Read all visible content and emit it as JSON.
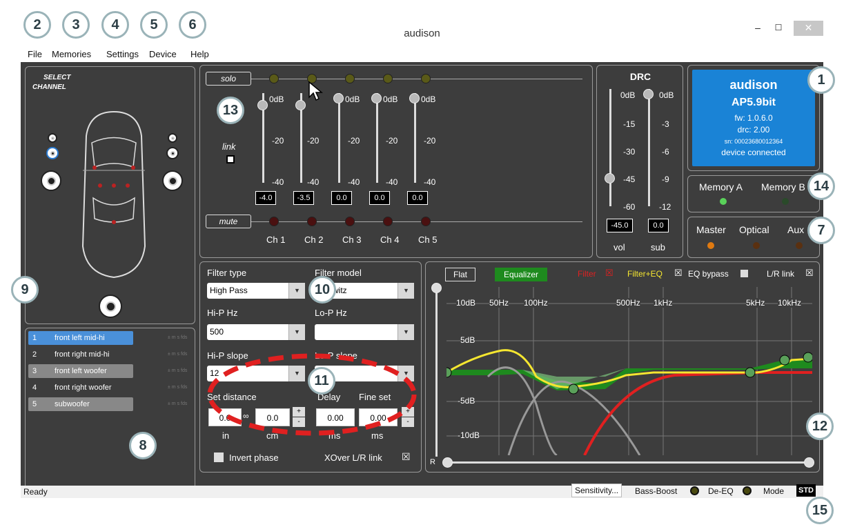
{
  "window": {
    "title": "audison",
    "minimize": "–",
    "maximize": "☐",
    "close": "✕"
  },
  "menu": [
    "File",
    "Memories",
    "Settings",
    "Device",
    "Help"
  ],
  "select_channel": {
    "line1": "SELECT",
    "line2": "CHANNEL"
  },
  "channels": [
    {
      "num": "1",
      "name": "front left mid-hi",
      "selected": true
    },
    {
      "num": "2",
      "name": "front right mid-hi",
      "selected": false
    },
    {
      "num": "3",
      "name": "front left woofer",
      "selected": false
    },
    {
      "num": "4",
      "name": "front right woofer",
      "selected": false
    },
    {
      "num": "5",
      "name": "subwoofer",
      "selected": false
    }
  ],
  "channel_flags": "± m s fds",
  "mixer": {
    "solo": "solo",
    "mute": "mute",
    "link": "link",
    "scale": [
      "0dB",
      "-20",
      "-40"
    ],
    "values": [
      "-4.0",
      "-3.5",
      "0.0",
      "0.0",
      "0.0"
    ],
    "labels": [
      "Ch 1",
      "Ch 2",
      "Ch 3",
      "Ch 4",
      "Ch 5"
    ]
  },
  "drc": {
    "title": "DRC",
    "vol_scale": [
      "0dB",
      "-15",
      "-30",
      "-45",
      "-60"
    ],
    "sub_scale": [
      "0dB",
      "-3",
      "-6",
      "-9",
      "-12"
    ],
    "vol_value": "-45.0",
    "sub_value": "0.0",
    "vol_label": "vol",
    "sub_label": "sub"
  },
  "device": {
    "brand": "audison",
    "model": "AP5.9bit",
    "fw": "fw: 1.0.6.0",
    "drc": "drc: 2.00",
    "sn": "sn: 00023680012364",
    "status": "device connected"
  },
  "memory": {
    "a": "Memory A",
    "b": "Memory B"
  },
  "inputs": {
    "master": "Master",
    "optical": "Optical",
    "aux": "Aux"
  },
  "filter": {
    "type_label": "Filter type",
    "type_value": "High Pass",
    "model_label": "Filter model",
    "model_value": "Linkwitz",
    "hip_label": "Hi-P Hz",
    "hip_value": "500",
    "lop_label": "Lo-P Hz",
    "lop_value": "",
    "hips_label": "Hi-P slope",
    "hips_value": "12",
    "lops_label": "Lo-P slope",
    "lops_value": "",
    "setdist_label": "Set distance",
    "delay_label": "Delay",
    "fineset_label": "Fine set",
    "dist_in": "0.0",
    "dist_cm": "0.0",
    "delay_ms": "0.00",
    "fine_ms": "0.00",
    "unit_in": "in",
    "unit_cm": "cm",
    "unit_ms1": "ms",
    "unit_ms2": "ms",
    "invert": "Invert phase",
    "xover": "XOver L/R link"
  },
  "eq": {
    "flat": "Flat",
    "equalizer": "Equalizer",
    "filter": "Filter",
    "filter_eq": "Filter+EQ",
    "bypass": "EQ bypass",
    "lr_link": "L/R link",
    "db_labels": [
      "10dB",
      "5dB",
      "-5dB",
      "-10dB"
    ],
    "freq_labels": [
      "50Hz",
      "100Hz",
      "500Hz",
      "1kHz",
      "5kHz",
      "10kHz"
    ],
    "r_label": "R"
  },
  "statusbar": {
    "ready": "Ready",
    "sensitivity": "Sensitivity...",
    "bassboost": "Bass-Boost",
    "deeq": "De-EQ",
    "mode": "Mode",
    "std": "STD"
  },
  "callouts": [
    "1",
    "2",
    "3",
    "4",
    "5",
    "6",
    "7",
    "8",
    "9",
    "10",
    "11",
    "12",
    "13",
    "14",
    "15"
  ],
  "colors": {
    "device_blue": "#1a83d6",
    "filter_red": "#e02020",
    "filter_eq_yellow": "#f5e630",
    "eq_green": "#1e8a1e",
    "selected_channel": "#4a90d9"
  }
}
